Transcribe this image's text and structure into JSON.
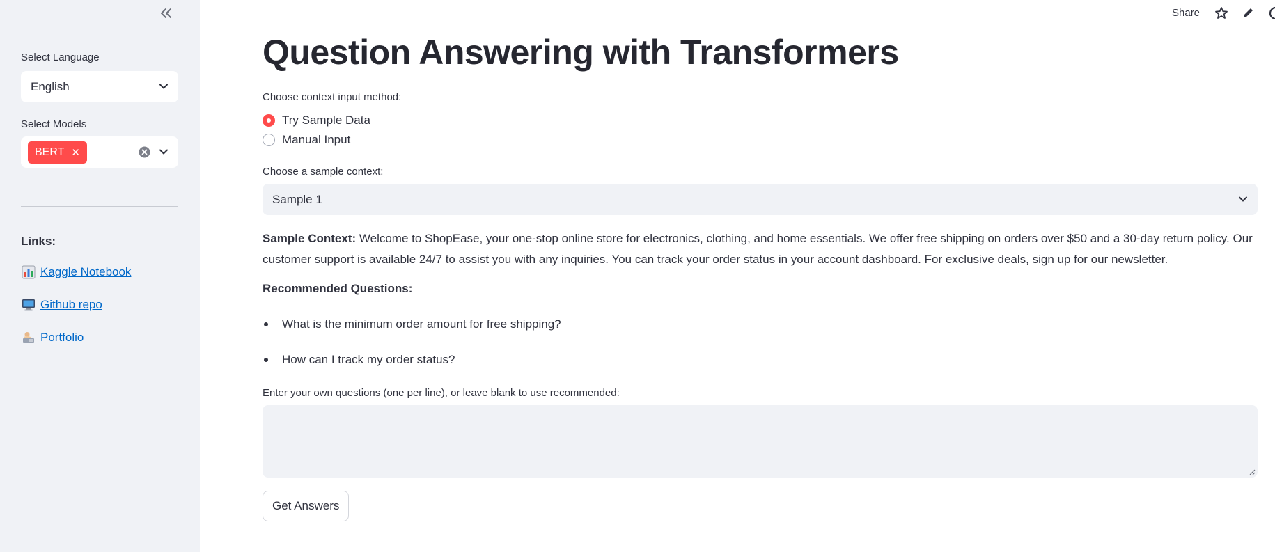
{
  "sidebar": {
    "language_label": "Select Language",
    "language_value": "English",
    "models_label": "Select Models",
    "model_tags": [
      "BERT"
    ],
    "links_title": "Links:",
    "links": [
      {
        "icon": "bar-chart-icon",
        "label": "Kaggle Notebook"
      },
      {
        "icon": "computer-icon",
        "label": "Github repo"
      },
      {
        "icon": "person-at-computer-icon",
        "label": "Portfolio"
      }
    ]
  },
  "toolbar": {
    "share_label": "Share"
  },
  "main": {
    "title": "Question Answering with Transformers",
    "input_method_label": "Choose context input method:",
    "input_methods": [
      "Try Sample Data",
      "Manual Input"
    ],
    "selected_input_method": "Try Sample Data",
    "sample_label": "Choose a sample context:",
    "sample_value": "Sample 1",
    "context_prefix": "Sample Context:",
    "context_text": "Welcome to ShopEase, your one-stop online store for electronics, clothing, and home essentials. We offer free shipping on orders over $50 and a 30-day return policy. Our customer support is available 24/7 to assist you with any inquiries. You can track your order status in your account dashboard. For exclusive deals, sign up for our newsletter.",
    "recommended_title": "Recommended Questions:",
    "recommended_questions": [
      "What is the minimum order amount for free shipping?",
      "How can I track my order status?"
    ],
    "questions_label": "Enter your own questions (one per line), or leave blank to use recommended:",
    "questions_value": "",
    "submit_label": "Get Answers"
  },
  "colors": {
    "accent": "#ff4b4b",
    "link": "#0068c9",
    "sidebar_bg": "#f0f2f6"
  }
}
